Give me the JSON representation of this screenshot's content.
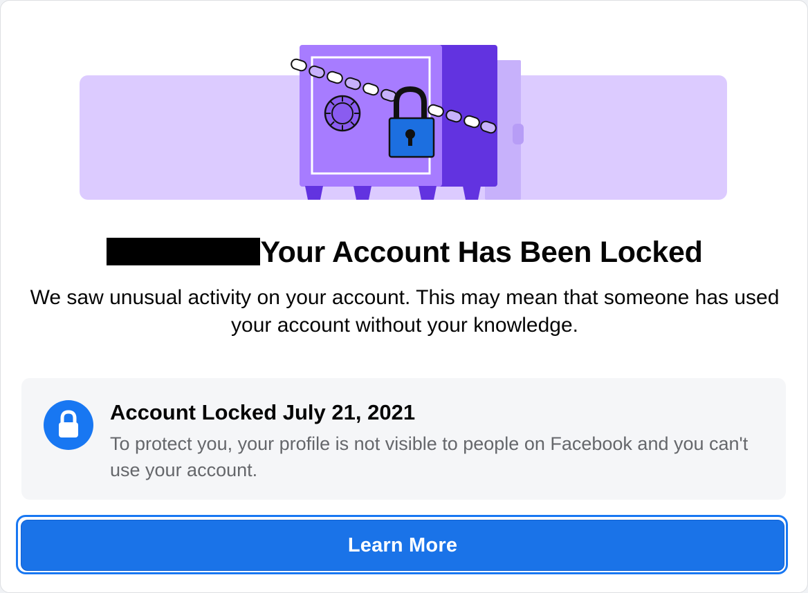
{
  "dialog": {
    "headline": "Your Account Has Been Locked",
    "description": "We saw unusual activity on your account. This may mean that someone has used your account without your knowledge."
  },
  "notice": {
    "icon": "lock-icon",
    "title": "Account Locked July 21, 2021",
    "text": "To protect you, your profile is not visible to people on Facebook and you can't use your account."
  },
  "actions": {
    "learn_more_label": "Learn More"
  },
  "colors": {
    "primary_blue": "#1877f2",
    "illustration_purple": "#a77cff",
    "illustration_lavender": "#dccbff"
  },
  "icons": {
    "illustration": "locked-safe-icon",
    "padlock": "padlock-icon"
  }
}
